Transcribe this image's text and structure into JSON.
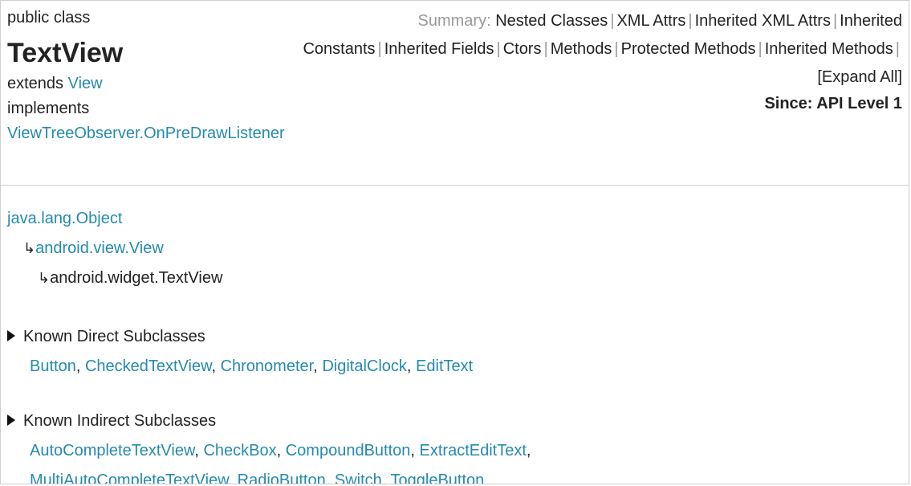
{
  "header": {
    "modifiers": "public class",
    "class_name": "TextView",
    "extends_label": "extends",
    "extends_link": "View",
    "implements_label": "implements",
    "implements_link": "ViewTreeObserver.OnPreDrawListener",
    "summary_label": "Summary:",
    "summary_links": [
      "Nested Classes",
      "XML Attrs",
      "Inherited XML Attrs",
      "Inherited Constants",
      "Inherited Fields",
      "Ctors",
      "Methods",
      "Protected Methods",
      "Inherited Methods",
      "[Expand All]"
    ],
    "since": "Since: API Level 1"
  },
  "inheritance": {
    "root": "java.lang.Object",
    "parent": "android.view.View",
    "current": "android.widget.TextView",
    "corner_glyph": "↳"
  },
  "direct_subclasses": {
    "title": "Known Direct Subclasses",
    "items": [
      "Button",
      "CheckedTextView",
      "Chronometer",
      "DigitalClock",
      "EditText"
    ]
  },
  "indirect_subclasses": {
    "title": "Known Indirect Subclasses",
    "items_line1": [
      "AutoCompleteTextView",
      "CheckBox",
      "CompoundButton",
      "ExtractEditText"
    ],
    "items_line2": [
      "MultiAutoCompleteTextView",
      "RadioButton",
      "Switch",
      "ToggleButton"
    ]
  },
  "colors": {
    "link": "#258aaf",
    "text": "#222222",
    "muted": "#999999",
    "border": "#cfcfcf"
  }
}
